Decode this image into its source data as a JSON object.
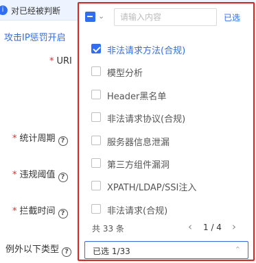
{
  "notice": {
    "icon": "info-icon",
    "text": "对已经被判断"
  },
  "section": {
    "title": "攻击IP惩罚开启"
  },
  "form": {
    "uri_label": "URI",
    "period_label": "统计周期",
    "threshold_label": "违规阈值",
    "block_time_label": "拦截时间",
    "exception_label": "例外以下类型"
  },
  "colors": {
    "accent": "#2f6df6",
    "highlight_border": "#e0231b",
    "required": "#f5222d"
  },
  "dropdown": {
    "search": {
      "placeholder": "请输入内容",
      "value": ""
    },
    "selected_link": "已选",
    "items": [
      {
        "label": "非法请求方法(合规)",
        "checked": true
      },
      {
        "label": "模型分析",
        "checked": false
      },
      {
        "label": "Header黑名单",
        "checked": false
      },
      {
        "label": "非法请求协议(合规)",
        "checked": false
      },
      {
        "label": "服务器信息泄漏",
        "checked": false
      },
      {
        "label": "第三方组件漏洞",
        "checked": false
      },
      {
        "label": "XPATH/LDAP/SSI注入",
        "checked": false
      },
      {
        "label": "非法请求(合规)",
        "checked": false
      }
    ],
    "total": "共 33 条",
    "pagination": {
      "current": "1",
      "separator": "/",
      "total_pages": "4",
      "text": "1 / 4"
    },
    "selected_value": "已选 1/33"
  }
}
